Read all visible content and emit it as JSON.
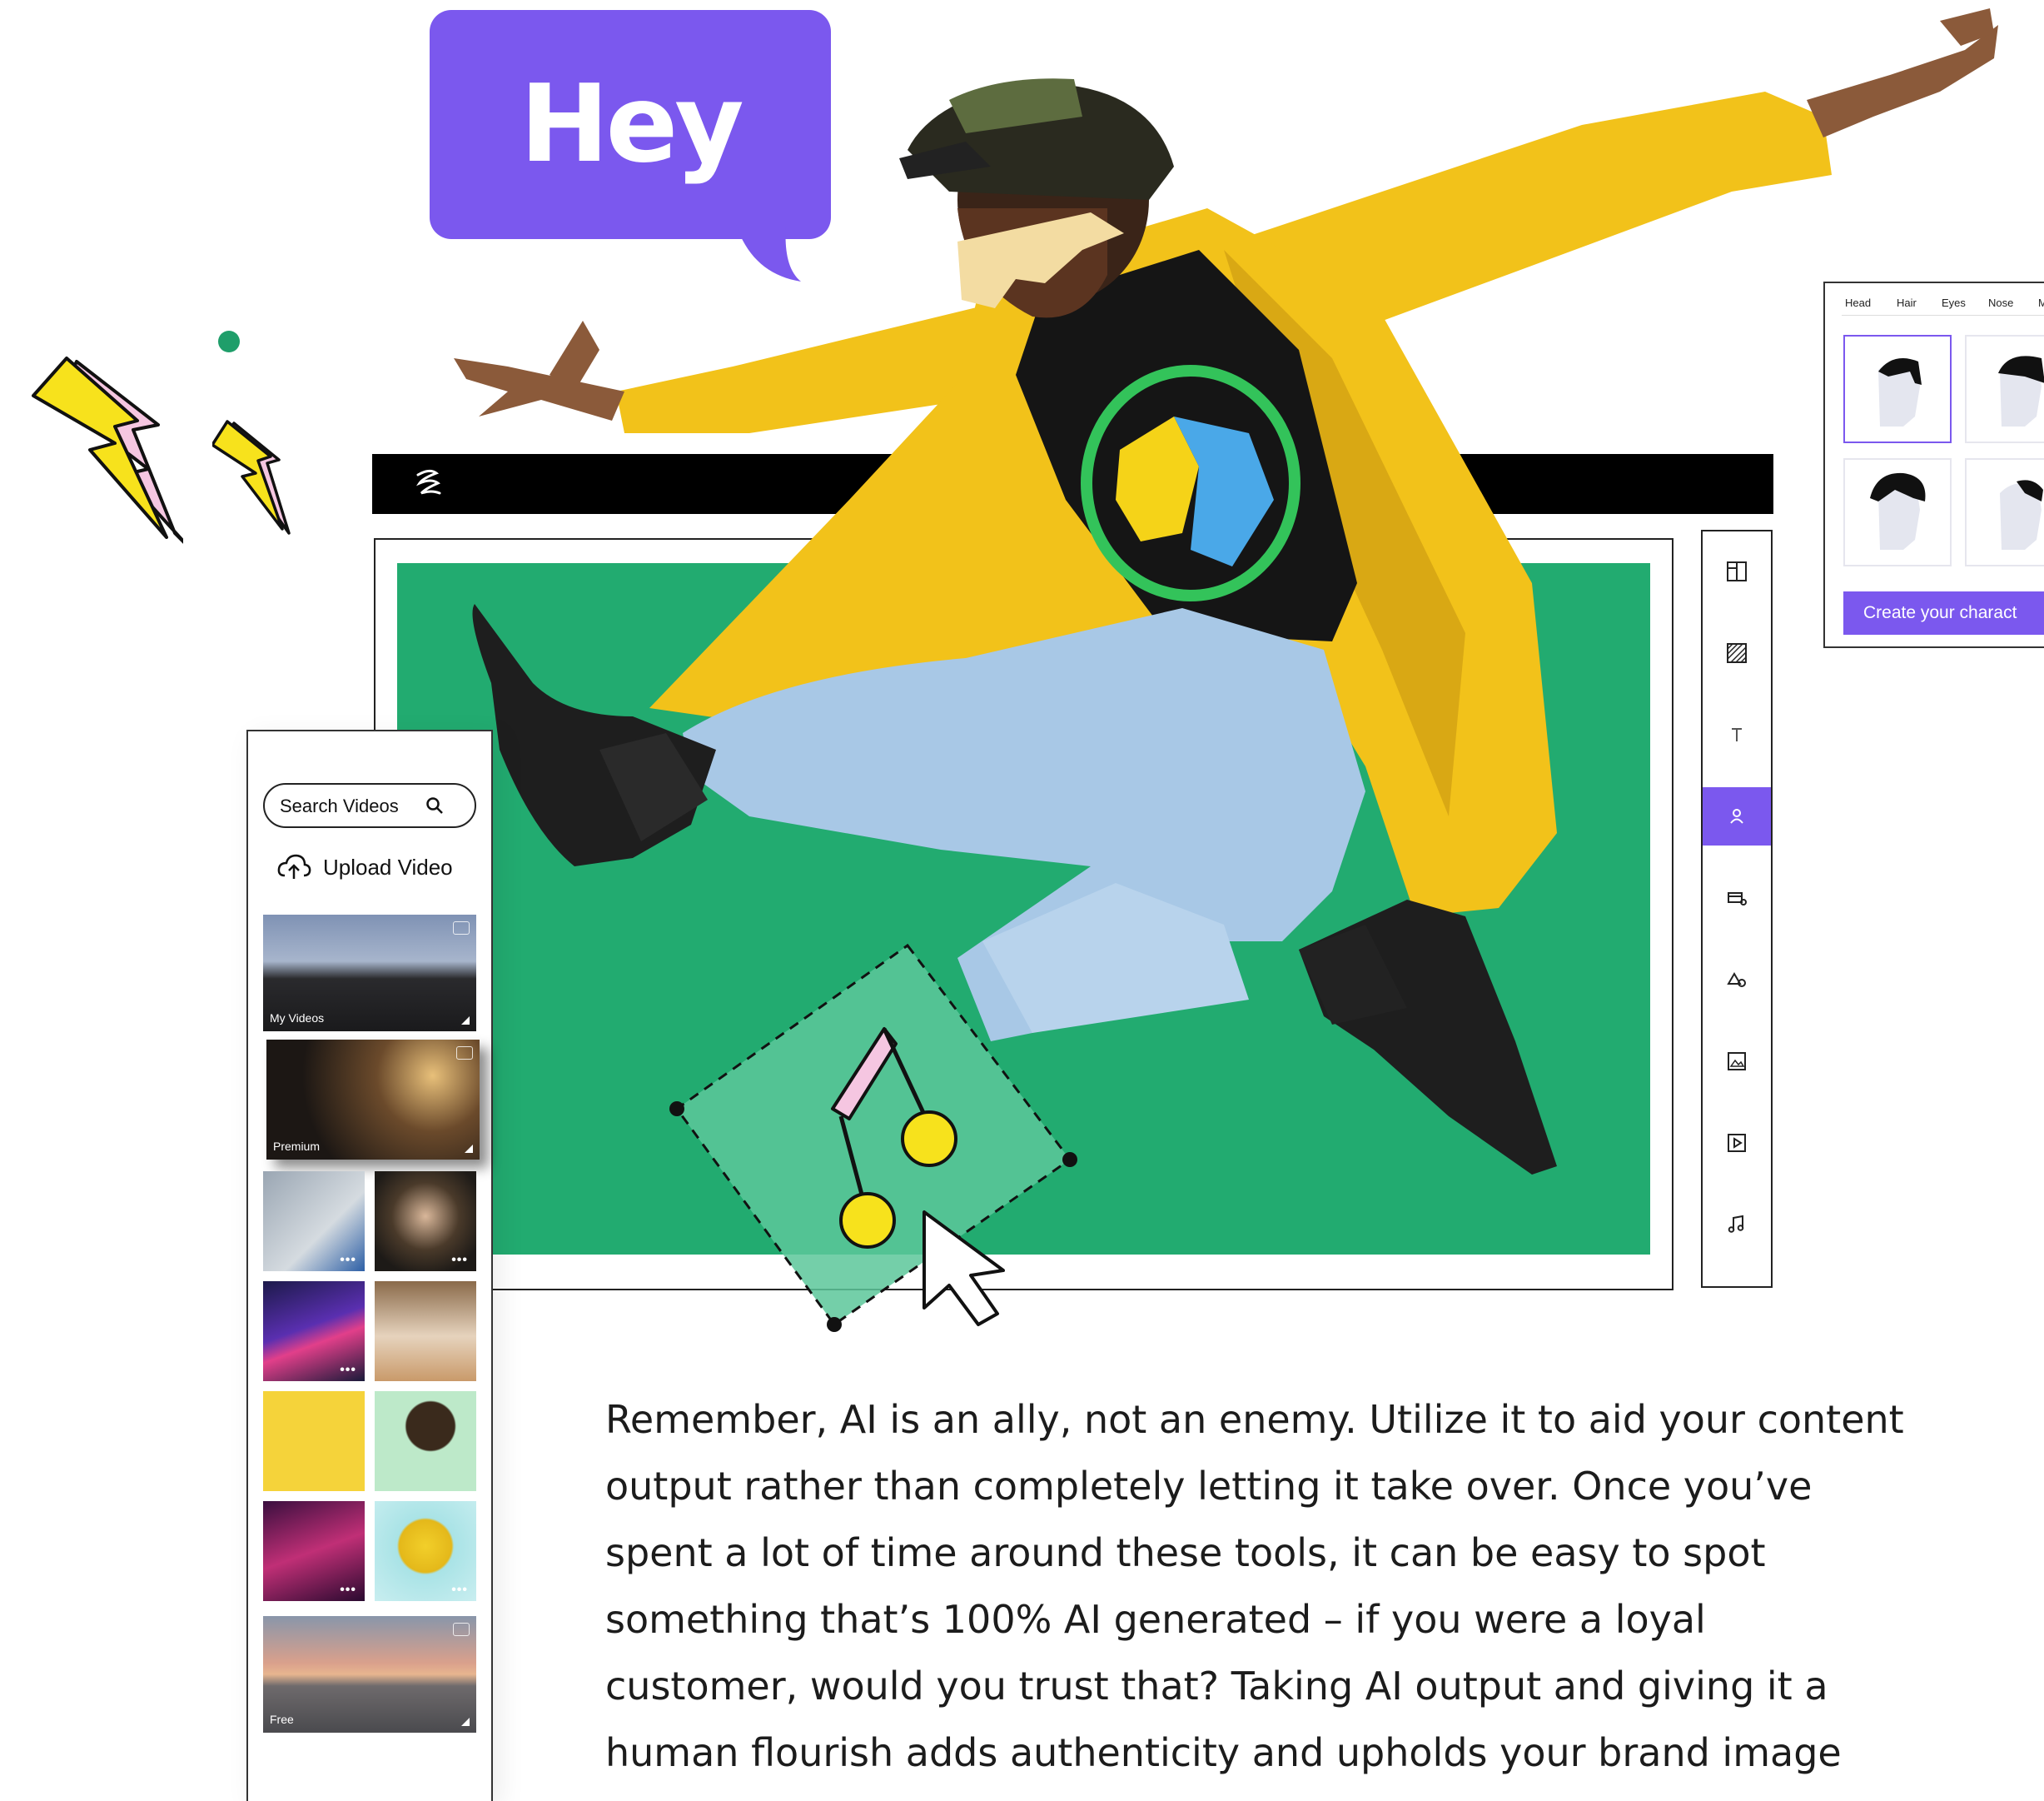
{
  "bubble": {
    "text": "Hey"
  },
  "media_panel": {
    "search_placeholder": "Search Videos",
    "upload_label": "Upload Video",
    "featured": [
      {
        "label": "My Videos"
      },
      {
        "label": "Premium"
      },
      {
        "label": "Free"
      }
    ]
  },
  "tool_rail": {
    "items": [
      "layout-icon",
      "pattern-icon",
      "text-icon",
      "character-icon",
      "props-icon",
      "shapes-icon",
      "image-icon",
      "video-icon",
      "music-icon"
    ],
    "active": "character-icon"
  },
  "character_panel": {
    "tabs": [
      "Head",
      "Hair",
      "Eyes",
      "Nose",
      "M"
    ],
    "cta_label": "Create your charact"
  },
  "body_text": {
    "lines": [
      "Remember, AI is an ally, not an enemy. Utilize it to aid your content",
      "output rather than completely letting it take over. Once you’ve",
      "spent a lot of time around these tools, it can be easy to spot",
      "something that’s 100% AI generated – if you were a loyal",
      "customer, would you trust that? Taking AI output and giving it a",
      "human flourish adds authenticity and upholds your brand image"
    ]
  },
  "colors": {
    "accent": "#7b58ee",
    "canvas": "#22ab70",
    "jacket": "#f2c21a",
    "lightning": "#f7e21c"
  }
}
